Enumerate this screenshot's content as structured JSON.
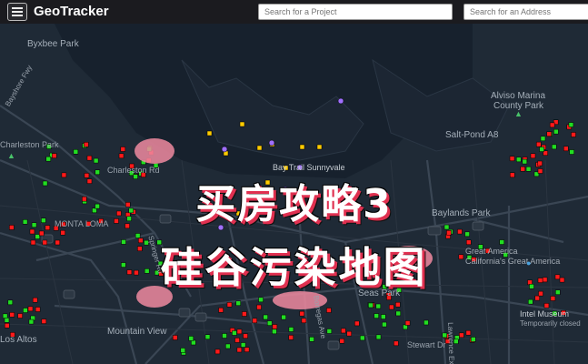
{
  "header": {
    "app_title": "GeoTracker",
    "project_search_placeholder": "Search for a Project",
    "address_search_placeholder": "Search for an Address",
    "menu_icon": "hamburger-menu-icon"
  },
  "map": {
    "labels": [
      {
        "text": "Byxbee Park"
      },
      {
        "text": "Alviso Marina"
      },
      {
        "text": "County Park"
      },
      {
        "text": "Salt-Pond A8"
      },
      {
        "text": "Charleston Rd"
      },
      {
        "text": "MONTA LOMA"
      },
      {
        "text": "Baylands Park"
      },
      {
        "text": "Seas Park"
      },
      {
        "text": "Intel Museum"
      },
      {
        "text": "Temporarily closed"
      },
      {
        "text": "Bay Trail Sunnyvale"
      },
      {
        "text": "Mountain View"
      },
      {
        "text": "Los Altos"
      },
      {
        "text": "Stewart Dr"
      },
      {
        "text": "Charleston Park"
      },
      {
        "text": "Bayshore Fwy"
      },
      {
        "text": "Springer Rd"
      },
      {
        "text": "Borregas Ave"
      },
      {
        "text": "Lawrence Expy"
      }
    ],
    "pois": [
      {
        "text": "Great America",
        "icon": "amusement-park-pin-icon"
      },
      {
        "text": "California's Great America",
        "icon": "amusement-park-pin-icon"
      }
    ],
    "colors": {
      "background": "#1f2a36",
      "road": "#3a4654",
      "open_case": "#ff1a1a",
      "closed_case": "#22dd22",
      "other_case": "#ffcc00",
      "violet_case": "#a070ff"
    }
  },
  "overlay": {
    "line1": "买房攻略3",
    "line2": "硅谷污染地图"
  }
}
